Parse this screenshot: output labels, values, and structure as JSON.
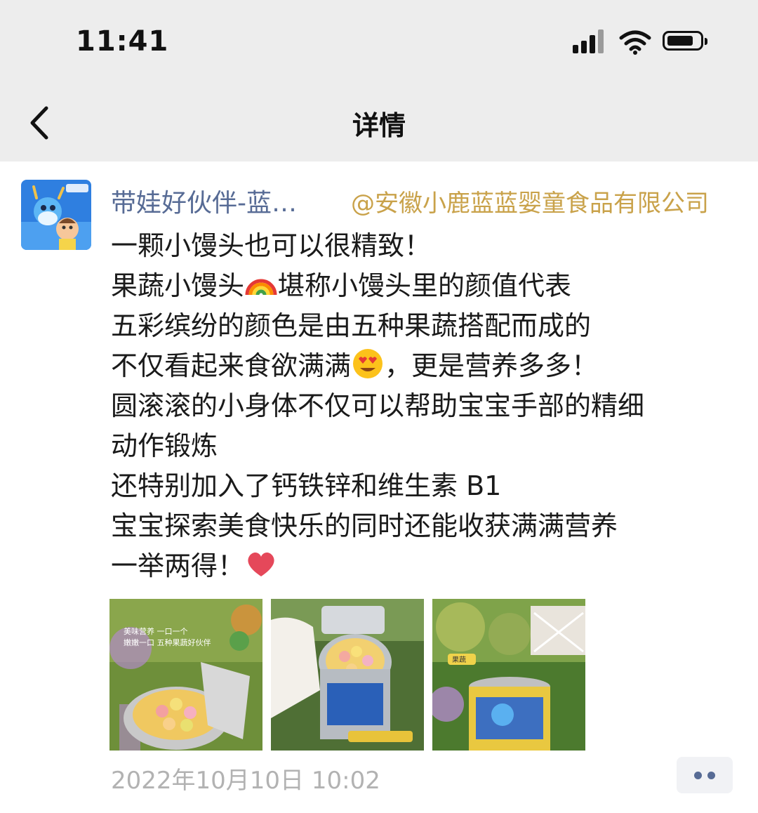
{
  "status_bar": {
    "time": "11:41"
  },
  "nav": {
    "title": "详情",
    "back_icon": "chevron-left-icon"
  },
  "post": {
    "author": "带娃好伙伴-蓝…",
    "company": "@安徽小鹿蓝蓝婴童食品有限公司",
    "lines": [
      {
        "text": "一颗小馒头也可以很精致！",
        "emoji": ""
      },
      {
        "text": "果蔬小馒头",
        "emoji": "rainbow",
        "after": "堪称小馒头里的颜值代表"
      },
      {
        "text": "五彩缤纷的颜色是由五种果蔬搭配而成的",
        "emoji": ""
      },
      {
        "text": "不仅看起来食欲满满",
        "emoji": "heart-eyes",
        "after": "，更是营养多多！"
      },
      {
        "text": "圆滚滚的小身体不仅可以帮助宝宝手部的精细",
        "emoji": ""
      },
      {
        "text": "动作锻炼",
        "emoji": ""
      },
      {
        "text": "还特别加入了钙铁锌和维生素 B1",
        "emoji": ""
      },
      {
        "text": "宝宝探索美食快乐的同时还能收获满满营养",
        "emoji": ""
      },
      {
        "text": "一举两得！",
        "emoji": "heart"
      }
    ],
    "photo_1_caption": "美味营养  一口一个\n嫩嫩一口  五种果蔬好伙伴",
    "photo_3_caption": "果蔬",
    "timestamp": "2022年10月10日 10:02",
    "more_icon": "more-dots-icon"
  },
  "colors": {
    "nav_bg": "#ededed",
    "author_link": "#576b95",
    "company_tag": "#c9a24a",
    "timestamp": "#b2b2b2"
  }
}
